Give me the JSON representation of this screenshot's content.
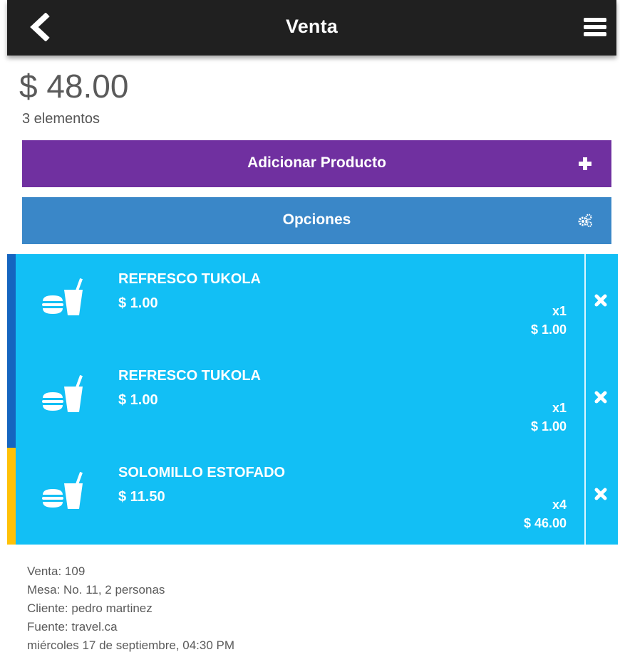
{
  "header": {
    "title": "Venta",
    "back_icon": "chevron-left-icon",
    "menu_icon": "hamburger-menu-icon"
  },
  "summary": {
    "total": "$ 48.00",
    "count": "3 elementos"
  },
  "actions": {
    "add_label": "Adicionar Producto",
    "add_icon": "plus-icon",
    "options_label": "Opciones",
    "options_icon": "gears-icon"
  },
  "items": [
    {
      "name": "REFRESCO TUKOLA",
      "price": "$ 1.00",
      "qty": "x1",
      "subtotal": "$ 1.00",
      "stripe_color": "#1565c0",
      "icon": "food-drink-icon",
      "remove_icon": "close-icon"
    },
    {
      "name": "REFRESCO TUKOLA",
      "price": "$ 1.00",
      "qty": "x1",
      "subtotal": "$ 1.00",
      "stripe_color": "#1565c0",
      "icon": "food-drink-icon",
      "remove_icon": "close-icon"
    },
    {
      "name": "SOLOMILLO ESTOFADO",
      "price": "$ 11.50",
      "qty": "x4",
      "subtotal": "$ 46.00",
      "stripe_color": "#ffc107",
      "icon": "food-drink-icon",
      "remove_icon": "close-icon"
    }
  ],
  "info": {
    "sale": "Venta: 109",
    "table": "Mesa: No. 11, 2 personas",
    "client": "Cliente: pedro martinez",
    "source": "Fuente: travel.ca",
    "date": "miércoles 17 de septiembre, 04:30 PM"
  },
  "colors": {
    "topbar": "#202020",
    "add_button": "#7030a0",
    "options_button": "#3a87c8",
    "item_bg": "#12bff5"
  }
}
